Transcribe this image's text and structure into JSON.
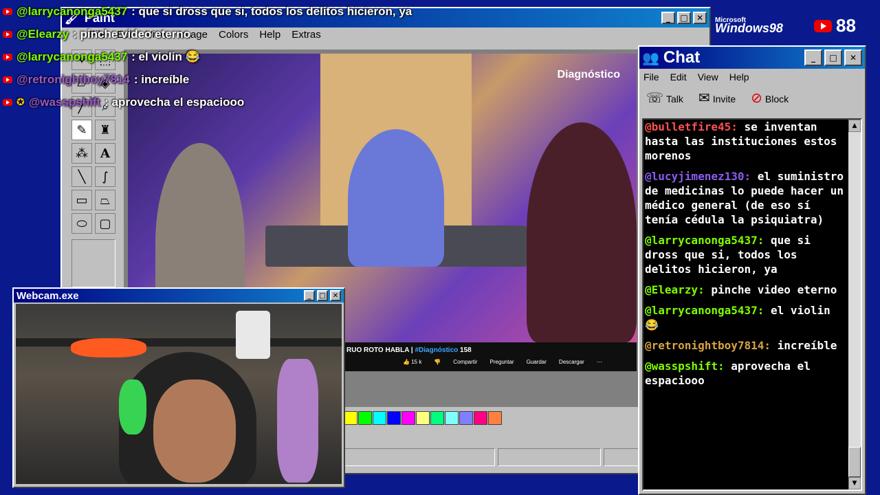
{
  "paint": {
    "title": "Paint",
    "menu": [
      "File",
      "Edit",
      "View",
      "Image",
      "Colors",
      "Help",
      "Extras"
    ],
    "palette": [
      "#ffff00",
      "#00ff00",
      "#00ffff",
      "#0000ff",
      "#ff00ff",
      "#ffff80",
      "#00ff80",
      "#80ffff",
      "#8080ff",
      "#ff0080",
      "#ff8040"
    ]
  },
  "video": {
    "logo": "Diagnóstico",
    "title_prefix": "RUO ROTO HABLA | ",
    "title_tag": "#Diagnóstico",
    "title_suffix": " 158",
    "likes": "15 k",
    "actions": [
      "Compartir",
      "Preguntar",
      "Guardar",
      "Descargar"
    ]
  },
  "overlay_chat": [
    {
      "user": "@larrycanonga5437",
      "text": ": que si dross que si, todos los delitos hicieron, ya",
      "color": "#7fff00"
    },
    {
      "user": "@Elearzy",
      "text": ": pinche video eterno",
      "color": "#7fff00"
    },
    {
      "user": "@larrycanonga5437",
      "text": ": el violin 😂",
      "color": "#7fff00"
    },
    {
      "user": "@retronightboy7814",
      "text": ": increíble",
      "color": "#9b59d0"
    },
    {
      "user": "@wasspshift",
      "text": ": aprovecha el espaciooo",
      "color": "#9b59d0"
    }
  ],
  "chat": {
    "title": "Chat",
    "menu": [
      "File",
      "Edit",
      "View",
      "Help"
    ],
    "toolbar": {
      "talk": "Talk",
      "invite": "Invite",
      "block": "Block"
    },
    "messages": [
      {
        "user": "@bulletfire45:",
        "text": " se inventan hasta las instituciones estos morenos",
        "color": "#ff5050"
      },
      {
        "user": "@lucyjimenez130:",
        "text": " el suministro de medicinas lo puede hacer un médico general (de eso sí tenía cédula la psiquiatra)",
        "color": "#8a5cf0"
      },
      {
        "user": "@larrycanonga5437:",
        "text": " que si dross que si, todos los delitos hicieron, ya",
        "color": "#7fff00"
      },
      {
        "user": "@Elearzy:",
        "text": " pinche video eterno",
        "color": "#7fff00"
      },
      {
        "user": "@larrycanonga5437:",
        "text": " el violin 😂",
        "color": "#7fff00"
      },
      {
        "user": "@retronightboy7814:",
        "text": " increíble",
        "color": "#d9a441"
      },
      {
        "user": "@wasspshift:",
        "text": " aprovecha el espaciooo",
        "color": "#7fff00"
      }
    ]
  },
  "webcam": {
    "title": "Webcam.exe"
  },
  "branding": {
    "microsoft": "Microsoft",
    "windows": "Windows98"
  },
  "viewers": "88"
}
